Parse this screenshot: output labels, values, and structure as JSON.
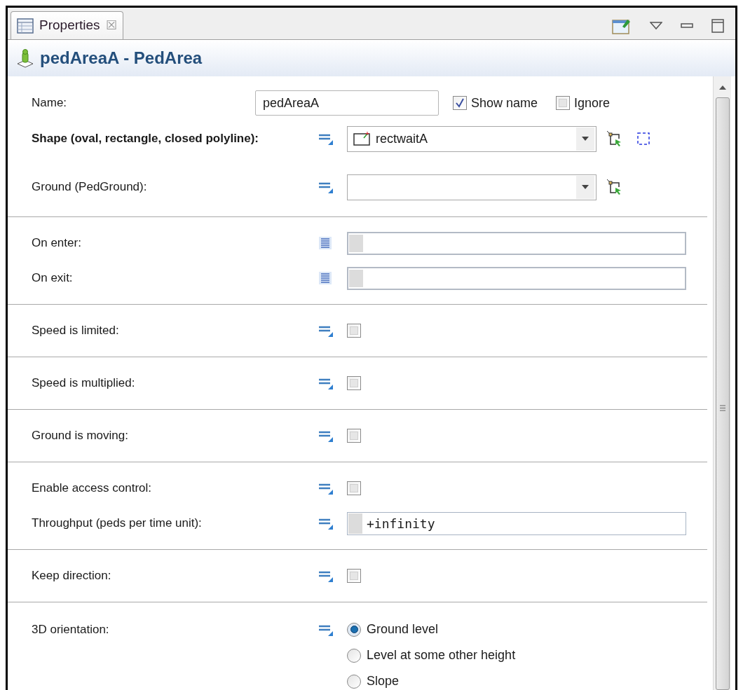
{
  "tab": {
    "label": "Properties",
    "close": "☒"
  },
  "header": {
    "title": "pedAreaA - PedArea"
  },
  "sections": [
    {
      "rows": [
        {
          "kind": "name",
          "label": "Name:",
          "value": "pedAreaA",
          "checks": [
            {
              "label": "Show name",
              "checked": true
            },
            {
              "label": "Ignore",
              "checked": false
            }
          ]
        },
        {
          "kind": "combo",
          "label": "Shape (oval, rectangle, closed polyline):",
          "bold": true,
          "value": "rectwaitA",
          "buttons": [
            {
              "kind": "pick"
            },
            {
              "kind": "select"
            }
          ]
        },
        {
          "kind": "combo",
          "label": "Ground (PedGround):",
          "bold": false,
          "buttons": [
            {
              "kind": "pick"
            }
          ]
        }
      ]
    },
    {
      "rows": [
        {
          "kind": "code",
          "label": "On enter:"
        },
        {
          "kind": "code",
          "label": "On exit:"
        }
      ]
    },
    {
      "rows": [
        {
          "kind": "checkbox",
          "label": "Speed is limited:",
          "checked": false
        }
      ]
    },
    {
      "rows": [
        {
          "kind": "checkbox",
          "label": "Speed is multiplied:",
          "checked": false
        }
      ]
    },
    {
      "rows": [
        {
          "kind": "checkbox",
          "label": "Ground is moving:",
          "checked": false
        }
      ]
    },
    {
      "rows": [
        {
          "kind": "checkbox",
          "label": "Enable access control:",
          "checked": false
        },
        {
          "kind": "text",
          "label": "Throughput (peds per time unit):",
          "value": "+infinity"
        }
      ]
    },
    {
      "rows": [
        {
          "kind": "checkbox",
          "label": "Keep direction:",
          "checked": false
        }
      ]
    },
    {
      "rows": [
        {
          "kind": "radio",
          "label": "3D orientation:",
          "options": [
            {
              "label": "Ground level",
              "selected": true
            },
            {
              "label": "Level at some other height",
              "selected": false
            },
            {
              "label": "Slope",
              "selected": false
            }
          ]
        }
      ]
    }
  ]
}
